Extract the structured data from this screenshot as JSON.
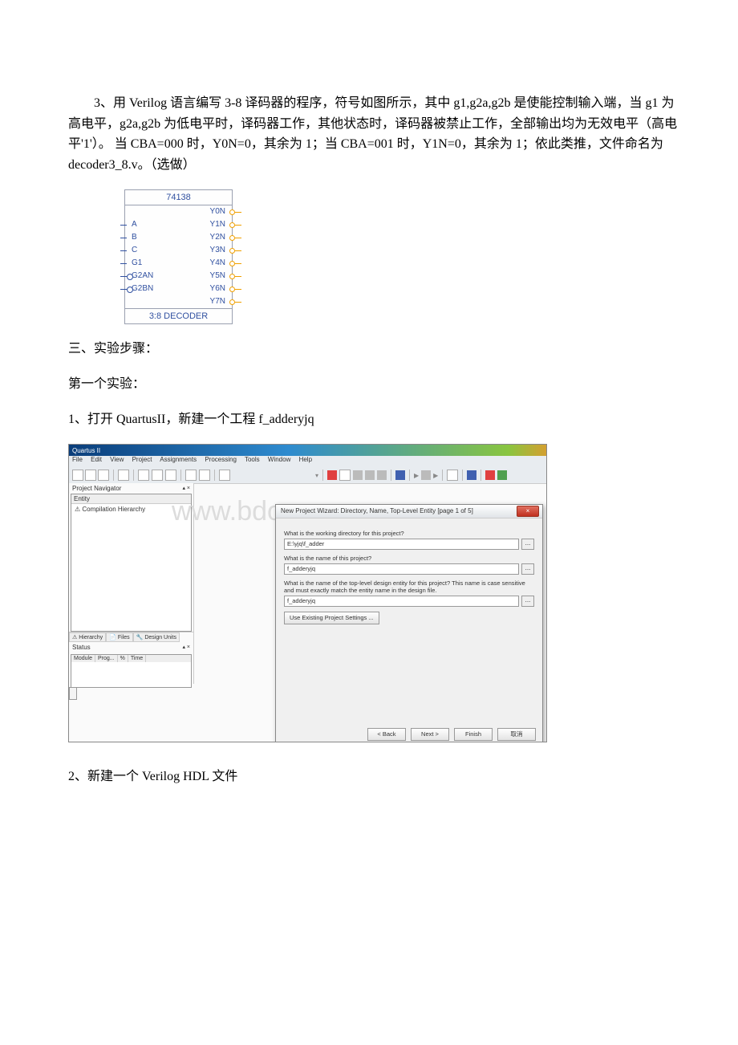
{
  "para1": "3、用 Verilog 语言编写 3-8 译码器的程序，符号如图所示，其中 g1,g2a,g2b 是使能控制输入端，当 g1 为高电平，g2a,g2b 为低电平时，译码器工作，其他状态时，译码器被禁止工作，全部输出均为无效电平（高电平'1'）。 当 CBA=000 时，Y0N=0，其余为 1；当 CBA=001 时，Y1N=0，其余为 1；依此类推，文件命名为 decoder3_8.v。（选做）",
  "ic": {
    "top": "74138",
    "left": [
      "A",
      "B",
      "C",
      "G1",
      "G2AN",
      "G2BN"
    ],
    "right": [
      "Y0N",
      "Y1N",
      "Y2N",
      "Y3N",
      "Y4N",
      "Y5N",
      "Y6N",
      "Y7N"
    ],
    "bottom": "3:8 DECODER"
  },
  "para2": "三、实验步骤：",
  "para3": "第一个实验：",
  "para4": "1、打开 QuartusII，新建一个工程 f_adderyjq",
  "screenshot": {
    "title": "Quartus II",
    "menu": [
      "File",
      "Edit",
      "View",
      "Project",
      "Assignments",
      "Processing",
      "Tools",
      "Window",
      "Help"
    ],
    "watermark": "www.bdocx.com",
    "nav_label": "Project Navigator",
    "entity_label": "Entity",
    "hierarchy_row": "Compilation Hierarchy",
    "left_tabs": [
      "Hierarchy",
      "Files",
      "Design Units"
    ],
    "status_label": "Status",
    "status_cols": [
      "Module",
      "Prog...",
      "%",
      "Time"
    ],
    "wizard": {
      "title": "New Project Wizard: Directory, Name, Top-Level Entity [page 1 of 5]",
      "q1": "What is the working directory for this project?",
      "v1": "E:\\yjq\\f_adder",
      "q2": "What is the name of this project?",
      "v2": "f_adderyjq",
      "q3": "What is the name of the top-level design entity for this project? This name is case sensitive and must exactly match the entity name in the design file.",
      "v3": "f_adderyjq",
      "settings_btn": "Use Existing Project Settings ...",
      "close": "×",
      "buttons": [
        "< Back",
        "Next >",
        "Finish",
        "取消"
      ]
    }
  },
  "para5": "2、新建一个 Verilog HDL 文件"
}
